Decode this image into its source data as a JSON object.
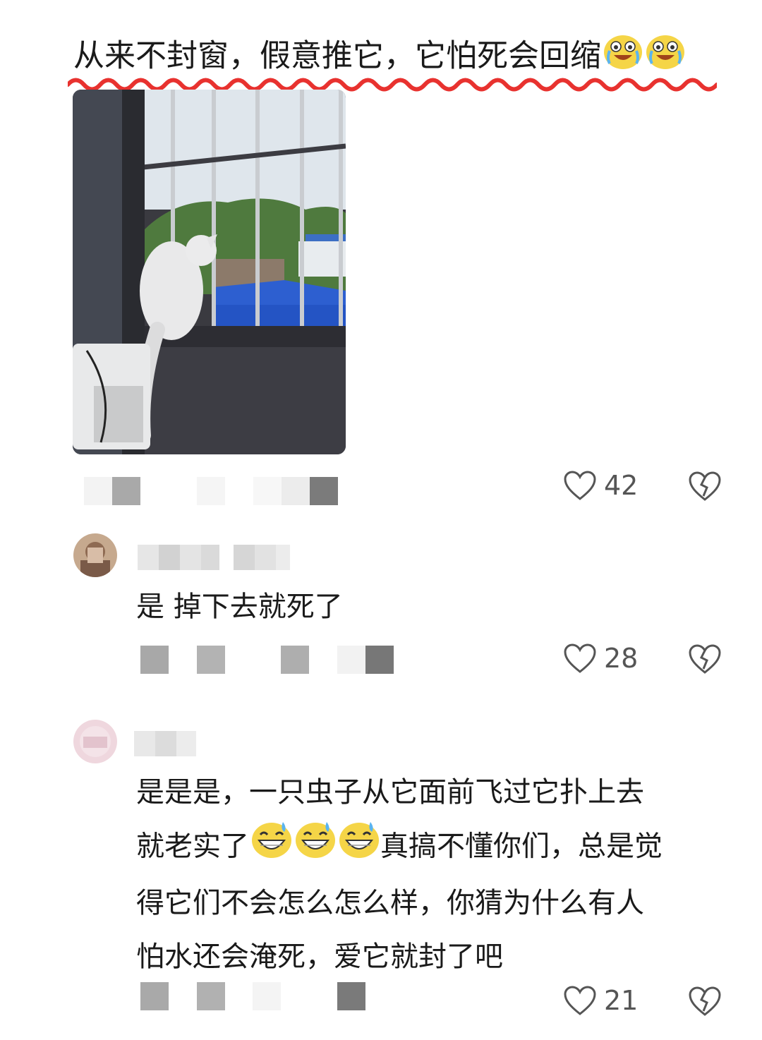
{
  "comments": [
    {
      "text": "从来不封窗，假意推它，它怕死会回缩",
      "emojis": [
        "crying-laughing-emoji",
        "crying-laughing-emoji"
      ],
      "likes": "42"
    },
    {
      "text": "是 掉下去就死了",
      "likes": "28"
    },
    {
      "text_line1": "是是是，一只虫子从它面前飞过它扑上去",
      "text_line2a": "就老实了",
      "text_line2b": "真搞不懂你们，总是觉",
      "text_line3": "得它们不会怎么怎么样，你猜为什么有人",
      "text_line4": "怕水还会淹死，爱它就封了吧",
      "emojis": [
        "sweat-grin-emoji",
        "sweat-grin-emoji",
        "sweat-grin-emoji"
      ],
      "likes": "21"
    }
  ],
  "icons": {
    "like": "heart-outline-icon",
    "dislike": "broken-heart-icon"
  },
  "colors": {
    "wavy_underline": "#e8322f",
    "meta_gray": "#9a9a9a",
    "text": "#1a1a1a"
  }
}
